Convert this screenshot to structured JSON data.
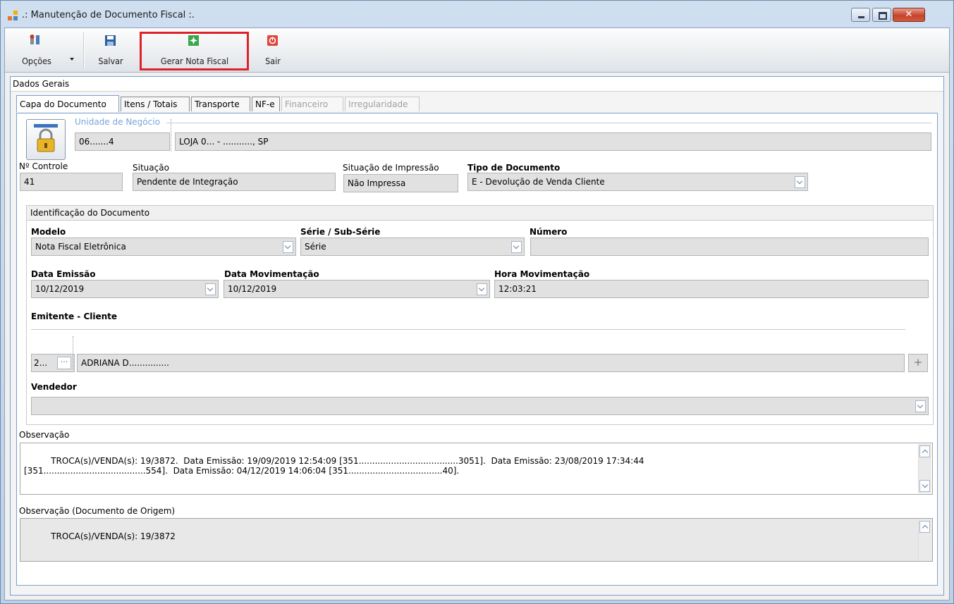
{
  "window": {
    "title": ".: Manutenção de Documento Fiscal :.",
    "close_glyph": "✕"
  },
  "toolbar": {
    "options_label": "Opções",
    "save_label": "Salvar",
    "generate_invoice_label": "Gerar Nota Fiscal",
    "exit_label": "Sair"
  },
  "panel": {
    "title": "Dados Gerais"
  },
  "tabs": [
    {
      "label": "Capa do Documento",
      "active": true
    },
    {
      "label": "Itens / Totais"
    },
    {
      "label": "Transporte"
    },
    {
      "label": "NF-e"
    },
    {
      "label": "Financeiro",
      "disabled": true
    },
    {
      "label": "Irregularidade",
      "disabled": true
    }
  ],
  "unidade": {
    "label": "Unidade de Negócio",
    "code": "06.......4",
    "name": "LOJA 0... - ..........., SP"
  },
  "header_fields": {
    "controle_label": "Nº Controle",
    "controle_value": "41",
    "situacao_label": "Situação",
    "situacao_value": "Pendente de Integração",
    "impressao_label": "Situação de Impressão",
    "impressao_value": "Não Impressa",
    "tipo_label": "Tipo de Documento",
    "tipo_value": "E - Devolução de Venda Cliente"
  },
  "identificacao": {
    "title": "Identificação do Documento",
    "modelo_label": "Modelo",
    "modelo_value": "Nota Fiscal Eletrônica",
    "serie_label": "Série / Sub-Série",
    "serie_value": "Série",
    "numero_label": "Número",
    "numero_value": "",
    "data_emissao_label": "Data Emissão",
    "data_emissao_value": "10/12/2019",
    "data_mov_label": "Data Movimentação",
    "data_mov_value": "10/12/2019",
    "hora_mov_label": "Hora Movimentação",
    "hora_mov_value": "12:03:21",
    "emitente_label": "Emitente - Cliente",
    "cliente_code": "2...",
    "cliente_browse": "···",
    "cliente_name": "ADRIANA D...............",
    "add_glyph": "+",
    "vendedor_label": "Vendedor",
    "vendedor_value": ""
  },
  "observacao": {
    "label": "Observação",
    "text": "TROCA(s)/VENDA(s): 19/3872.  Data Emissão: 19/09/2019 12:54:09 [351.....................................3051].  Data Emissão: 23/08/2019 17:34:44\n[351......................................554].  Data Emissão: 04/12/2019 14:06:04 [351...................................40]."
  },
  "observacao_origem": {
    "label": "Observação (Documento de Origem)",
    "text": "TROCA(s)/VENDA(s): 19/3872"
  }
}
